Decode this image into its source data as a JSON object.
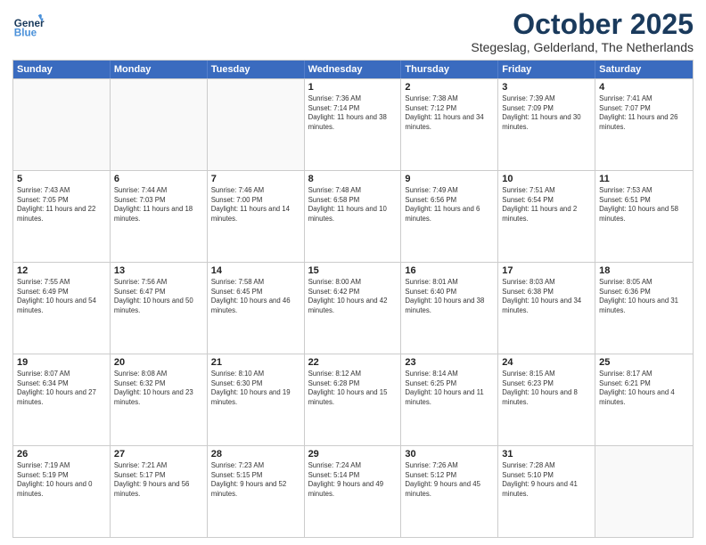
{
  "header": {
    "logo": {
      "general": "General",
      "blue": "Blue"
    },
    "month": "October 2025",
    "location": "Stegeslag, Gelderland, The Netherlands"
  },
  "weekdays": [
    "Sunday",
    "Monday",
    "Tuesday",
    "Wednesday",
    "Thursday",
    "Friday",
    "Saturday"
  ],
  "weeks": [
    [
      {
        "date": "",
        "sunrise": "",
        "sunset": "",
        "daylight": "",
        "empty": true
      },
      {
        "date": "",
        "sunrise": "",
        "sunset": "",
        "daylight": "",
        "empty": true
      },
      {
        "date": "",
        "sunrise": "",
        "sunset": "",
        "daylight": "",
        "empty": true
      },
      {
        "date": "1",
        "sunrise": "Sunrise: 7:36 AM",
        "sunset": "Sunset: 7:14 PM",
        "daylight": "Daylight: 11 hours and 38 minutes.",
        "empty": false
      },
      {
        "date": "2",
        "sunrise": "Sunrise: 7:38 AM",
        "sunset": "Sunset: 7:12 PM",
        "daylight": "Daylight: 11 hours and 34 minutes.",
        "empty": false
      },
      {
        "date": "3",
        "sunrise": "Sunrise: 7:39 AM",
        "sunset": "Sunset: 7:09 PM",
        "daylight": "Daylight: 11 hours and 30 minutes.",
        "empty": false
      },
      {
        "date": "4",
        "sunrise": "Sunrise: 7:41 AM",
        "sunset": "Sunset: 7:07 PM",
        "daylight": "Daylight: 11 hours and 26 minutes.",
        "empty": false
      }
    ],
    [
      {
        "date": "5",
        "sunrise": "Sunrise: 7:43 AM",
        "sunset": "Sunset: 7:05 PM",
        "daylight": "Daylight: 11 hours and 22 minutes.",
        "empty": false
      },
      {
        "date": "6",
        "sunrise": "Sunrise: 7:44 AM",
        "sunset": "Sunset: 7:03 PM",
        "daylight": "Daylight: 11 hours and 18 minutes.",
        "empty": false
      },
      {
        "date": "7",
        "sunrise": "Sunrise: 7:46 AM",
        "sunset": "Sunset: 7:00 PM",
        "daylight": "Daylight: 11 hours and 14 minutes.",
        "empty": false
      },
      {
        "date": "8",
        "sunrise": "Sunrise: 7:48 AM",
        "sunset": "Sunset: 6:58 PM",
        "daylight": "Daylight: 11 hours and 10 minutes.",
        "empty": false
      },
      {
        "date": "9",
        "sunrise": "Sunrise: 7:49 AM",
        "sunset": "Sunset: 6:56 PM",
        "daylight": "Daylight: 11 hours and 6 minutes.",
        "empty": false
      },
      {
        "date": "10",
        "sunrise": "Sunrise: 7:51 AM",
        "sunset": "Sunset: 6:54 PM",
        "daylight": "Daylight: 11 hours and 2 minutes.",
        "empty": false
      },
      {
        "date": "11",
        "sunrise": "Sunrise: 7:53 AM",
        "sunset": "Sunset: 6:51 PM",
        "daylight": "Daylight: 10 hours and 58 minutes.",
        "empty": false
      }
    ],
    [
      {
        "date": "12",
        "sunrise": "Sunrise: 7:55 AM",
        "sunset": "Sunset: 6:49 PM",
        "daylight": "Daylight: 10 hours and 54 minutes.",
        "empty": false
      },
      {
        "date": "13",
        "sunrise": "Sunrise: 7:56 AM",
        "sunset": "Sunset: 6:47 PM",
        "daylight": "Daylight: 10 hours and 50 minutes.",
        "empty": false
      },
      {
        "date": "14",
        "sunrise": "Sunrise: 7:58 AM",
        "sunset": "Sunset: 6:45 PM",
        "daylight": "Daylight: 10 hours and 46 minutes.",
        "empty": false
      },
      {
        "date": "15",
        "sunrise": "Sunrise: 8:00 AM",
        "sunset": "Sunset: 6:42 PM",
        "daylight": "Daylight: 10 hours and 42 minutes.",
        "empty": false
      },
      {
        "date": "16",
        "sunrise": "Sunrise: 8:01 AM",
        "sunset": "Sunset: 6:40 PM",
        "daylight": "Daylight: 10 hours and 38 minutes.",
        "empty": false
      },
      {
        "date": "17",
        "sunrise": "Sunrise: 8:03 AM",
        "sunset": "Sunset: 6:38 PM",
        "daylight": "Daylight: 10 hours and 34 minutes.",
        "empty": false
      },
      {
        "date": "18",
        "sunrise": "Sunrise: 8:05 AM",
        "sunset": "Sunset: 6:36 PM",
        "daylight": "Daylight: 10 hours and 31 minutes.",
        "empty": false
      }
    ],
    [
      {
        "date": "19",
        "sunrise": "Sunrise: 8:07 AM",
        "sunset": "Sunset: 6:34 PM",
        "daylight": "Daylight: 10 hours and 27 minutes.",
        "empty": false
      },
      {
        "date": "20",
        "sunrise": "Sunrise: 8:08 AM",
        "sunset": "Sunset: 6:32 PM",
        "daylight": "Daylight: 10 hours and 23 minutes.",
        "empty": false
      },
      {
        "date": "21",
        "sunrise": "Sunrise: 8:10 AM",
        "sunset": "Sunset: 6:30 PM",
        "daylight": "Daylight: 10 hours and 19 minutes.",
        "empty": false
      },
      {
        "date": "22",
        "sunrise": "Sunrise: 8:12 AM",
        "sunset": "Sunset: 6:28 PM",
        "daylight": "Daylight: 10 hours and 15 minutes.",
        "empty": false
      },
      {
        "date": "23",
        "sunrise": "Sunrise: 8:14 AM",
        "sunset": "Sunset: 6:25 PM",
        "daylight": "Daylight: 10 hours and 11 minutes.",
        "empty": false
      },
      {
        "date": "24",
        "sunrise": "Sunrise: 8:15 AM",
        "sunset": "Sunset: 6:23 PM",
        "daylight": "Daylight: 10 hours and 8 minutes.",
        "empty": false
      },
      {
        "date": "25",
        "sunrise": "Sunrise: 8:17 AM",
        "sunset": "Sunset: 6:21 PM",
        "daylight": "Daylight: 10 hours and 4 minutes.",
        "empty": false
      }
    ],
    [
      {
        "date": "26",
        "sunrise": "Sunrise: 7:19 AM",
        "sunset": "Sunset: 5:19 PM",
        "daylight": "Daylight: 10 hours and 0 minutes.",
        "empty": false
      },
      {
        "date": "27",
        "sunrise": "Sunrise: 7:21 AM",
        "sunset": "Sunset: 5:17 PM",
        "daylight": "Daylight: 9 hours and 56 minutes.",
        "empty": false
      },
      {
        "date": "28",
        "sunrise": "Sunrise: 7:23 AM",
        "sunset": "Sunset: 5:15 PM",
        "daylight": "Daylight: 9 hours and 52 minutes.",
        "empty": false
      },
      {
        "date": "29",
        "sunrise": "Sunrise: 7:24 AM",
        "sunset": "Sunset: 5:14 PM",
        "daylight": "Daylight: 9 hours and 49 minutes.",
        "empty": false
      },
      {
        "date": "30",
        "sunrise": "Sunrise: 7:26 AM",
        "sunset": "Sunset: 5:12 PM",
        "daylight": "Daylight: 9 hours and 45 minutes.",
        "empty": false
      },
      {
        "date": "31",
        "sunrise": "Sunrise: 7:28 AM",
        "sunset": "Sunset: 5:10 PM",
        "daylight": "Daylight: 9 hours and 41 minutes.",
        "empty": false
      },
      {
        "date": "",
        "sunrise": "",
        "sunset": "",
        "daylight": "",
        "empty": true
      }
    ]
  ]
}
